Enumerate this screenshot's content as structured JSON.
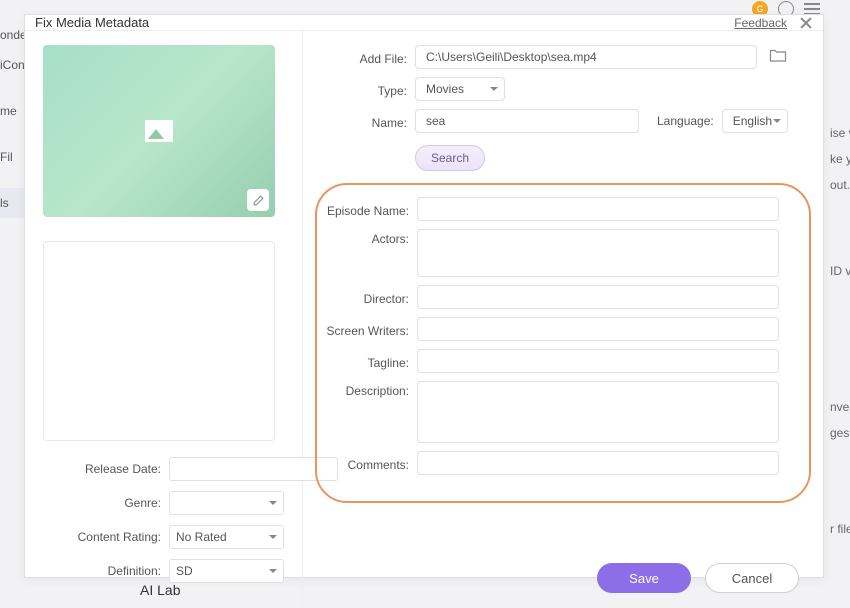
{
  "bg": {
    "sidebar": [
      "onde",
      "iCon",
      "me",
      "Fil",
      "ls"
    ],
    "right": [
      "ise vi",
      "ke yo",
      " out.",
      "ID vi",
      "nver",
      "ges t",
      "r files"
    ],
    "bottom": "AI Lab"
  },
  "dialog": {
    "title": "Fix Media Metadata",
    "feedback": "Feedback"
  },
  "fields": {
    "add_file_label": "Add File:",
    "add_file_value": "C:\\Users\\Geili\\Desktop\\sea.mp4",
    "type_label": "Type:",
    "type_value": "Movies",
    "name_label": "Name:",
    "name_value": "sea",
    "language_label": "Language:",
    "language_value": "English",
    "search_btn": "Search",
    "episode_label": "Episode Name:",
    "episode_value": "",
    "actors_label": "Actors:",
    "actors_value": "",
    "director_label": "Director:",
    "director_value": "",
    "writers_label": "Screen Writers:",
    "writers_value": "",
    "tagline_label": "Tagline:",
    "tagline_value": "",
    "description_label": "Description:",
    "description_value": "",
    "comments_label": "Comments:",
    "comments_value": "",
    "release_label": "Release Date:",
    "release_value": "",
    "genre_label": "Genre:",
    "genre_value": "",
    "rating_label": "Content Rating:",
    "rating_value": "No Rated",
    "definition_label": "Definition:",
    "definition_value": "SD"
  },
  "buttons": {
    "save": "Save",
    "cancel": "Cancel"
  }
}
